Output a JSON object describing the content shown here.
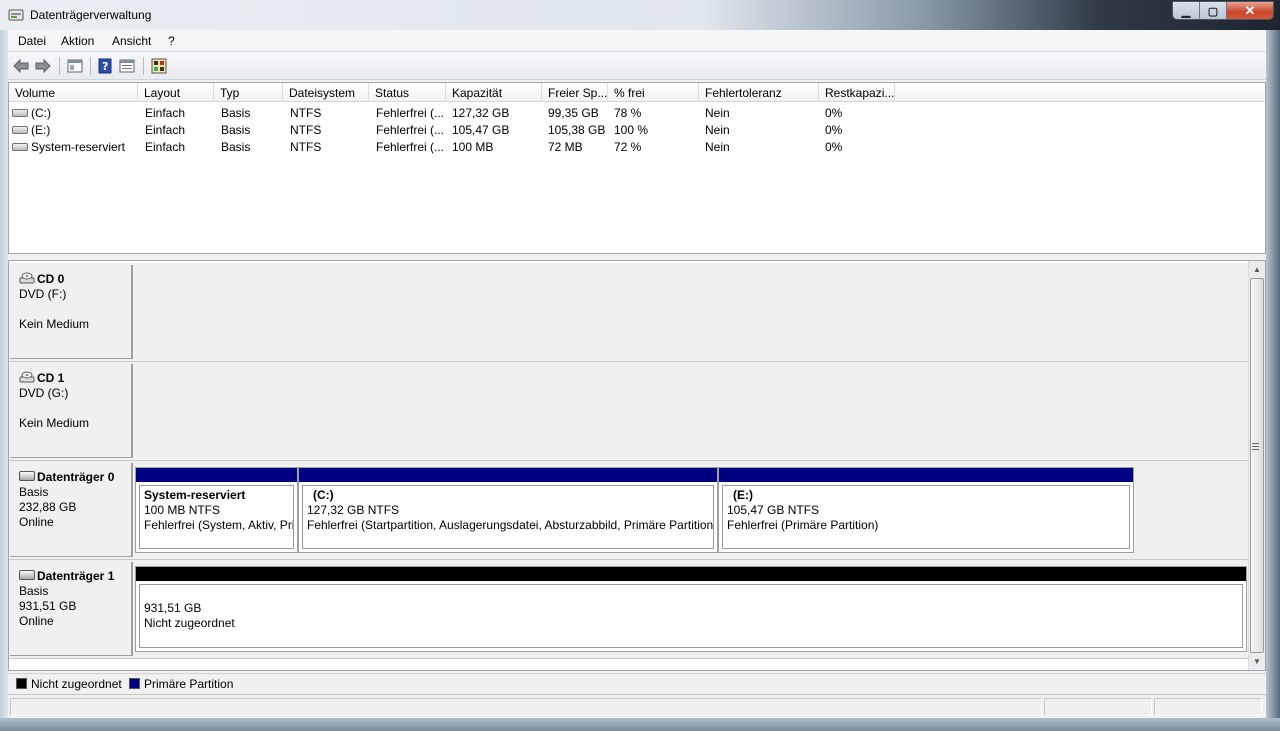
{
  "window": {
    "title": "Datenträgerverwaltung"
  },
  "menu": [
    "Datei",
    "Aktion",
    "Ansicht",
    "?"
  ],
  "toolbar": {
    "icons": [
      "back-arrow-icon",
      "forward-arrow-icon",
      "console-tree-icon",
      "help-icon",
      "properties-icon",
      "settings-icon"
    ]
  },
  "volume_list": {
    "columns": [
      "Volume",
      "Layout",
      "Typ",
      "Dateisystem",
      "Status",
      "Kapazität",
      "Freier Sp...",
      "% frei",
      "Fehlertoleranz",
      "Restkapazi..."
    ],
    "rows": [
      [
        "(C:)",
        "Einfach",
        "Basis",
        "NTFS",
        "Fehlerfrei (...",
        "127,32 GB",
        "99,35 GB",
        "78 %",
        "Nein",
        "0%"
      ],
      [
        "(E:)",
        "Einfach",
        "Basis",
        "NTFS",
        "Fehlerfrei (...",
        "105,47 GB",
        "105,38 GB",
        "100 %",
        "Nein",
        "0%"
      ],
      [
        "System-reserviert",
        "Einfach",
        "Basis",
        "NTFS",
        "Fehlerfrei (...",
        "100 MB",
        "72 MB",
        "72 %",
        "Nein",
        "0%"
      ]
    ]
  },
  "disks": [
    {
      "name": "CD 0",
      "line1": "DVD (F:)",
      "line2": "",
      "line3": "Kein Medium",
      "kind": "cd"
    },
    {
      "name": "CD 1",
      "line1": "DVD (G:)",
      "line2": "",
      "line3": "Kein Medium",
      "kind": "cd"
    },
    {
      "name": "Datenträger 0",
      "line1": "Basis",
      "line2": "232,88 GB",
      "line3": "Online",
      "kind": "disk",
      "partitions": [
        {
          "name": "System-reserviert",
          "size": "100 MB NTFS",
          "status": "Fehlerfrei (System, Aktiv, Primäre Partition)"
        },
        {
          "name": "(C:)",
          "size": "127,32 GB NTFS",
          "status": "Fehlerfrei (Startpartition, Auslagerungsdatei, Absturzabbild, Primäre Partition)"
        },
        {
          "name": "(E:)",
          "size": "105,47 GB NTFS",
          "status": "Fehlerfrei (Primäre Partition)"
        }
      ]
    },
    {
      "name": "Datenträger 1",
      "line1": "Basis",
      "line2": "931,51 GB",
      "line3": "Online",
      "kind": "disk",
      "partitions": [
        {
          "name": "",
          "size": "931,51 GB",
          "status": "Nicht zugeordnet"
        }
      ]
    }
  ],
  "legend": [
    {
      "label": "Nicht zugeordnet",
      "color": "#000000"
    },
    {
      "label": "Primäre Partition",
      "color": "#000080"
    }
  ],
  "colors": {
    "primary_partition": "#000080",
    "unallocated": "#000000"
  }
}
